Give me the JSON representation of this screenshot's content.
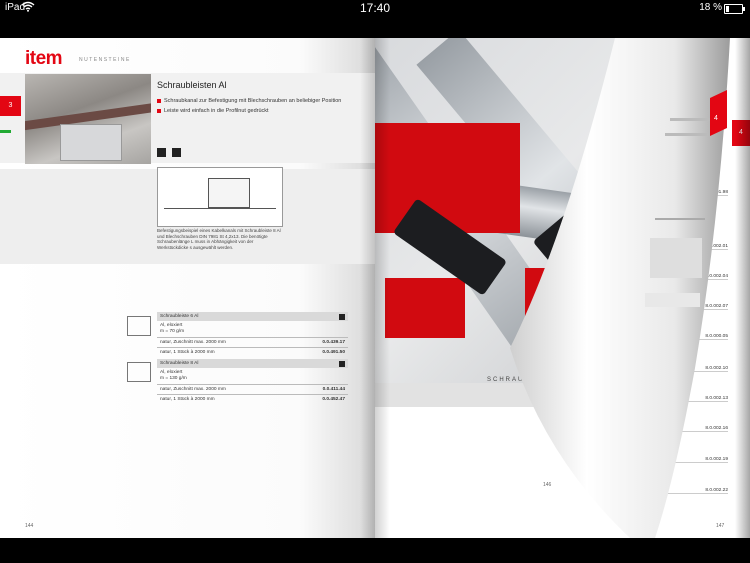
{
  "status_bar": {
    "carrier": "iPad",
    "time": "17:40",
    "battery_pct": "18 %",
    "battery_level": 0.18,
    "wifi_icon": "wifi-icon"
  },
  "left_page": {
    "logo": "item",
    "logo_sub": "NUTENSTEINE",
    "chapter_tab": "3",
    "product_title": "Schraubleisten Al",
    "bullets": [
      "Schraubkanal zur Befestigung mit Blechschrauben an beliebiger Position",
      "Leiste wird einfach in die Profilnut gedrückt"
    ],
    "caption": "Befestigungsbeispiel eines Kabelkanals mit Schraubleiste 8 Al und Blechschrauben DIN 7981 St 4,2x13. Die benötigte Schraubenlänge L muss in Abhängigkeit von der Werkstückdicke s ausgewählt werden.",
    "tables": [
      {
        "title": "Schraubleiste 6 Al",
        "sub1": "Al, eloxiert",
        "sub2": "m = 70 g/m",
        "rows": [
          {
            "label": "natur, Zuschnitt max. 2000 mm",
            "code": "0.0.439.17"
          },
          {
            "label": "natur, 1 Stück à 2000 mm",
            "code": "0.0.491.50"
          }
        ]
      },
      {
        "title": "Schraubleiste 8 Al",
        "sub1": "Al, eloxiert",
        "sub2": "m = 130 g/m",
        "rows": [
          {
            "label": "natur, Zuschnitt max. 2000 mm",
            "code": "0.0.411.44"
          },
          {
            "label": "natur, 1 Stück à 2000 mm",
            "code": "0.0.452.47"
          }
        ]
      }
    ],
    "page_number": "144"
  },
  "right_page": {
    "chapter_tab": "4",
    "section_text": "SCHRAUBEN UND U",
    "curl_tab": "4",
    "curl_page_number": "146",
    "page_number": "147",
    "codes": [
      "8.0.001.98",
      "8.0.002.01",
      "8.0.002.04",
      "8.0.002.07",
      "8.0.000.05",
      "8.0.002.10",
      "8.0.002.13",
      "8.0.002.16",
      "8.0.002.19",
      "8.0.002.22"
    ]
  },
  "colors": {
    "brand_red": "#e30613",
    "accent_green": "#22aa33",
    "status_bar_bg": "#000000"
  }
}
